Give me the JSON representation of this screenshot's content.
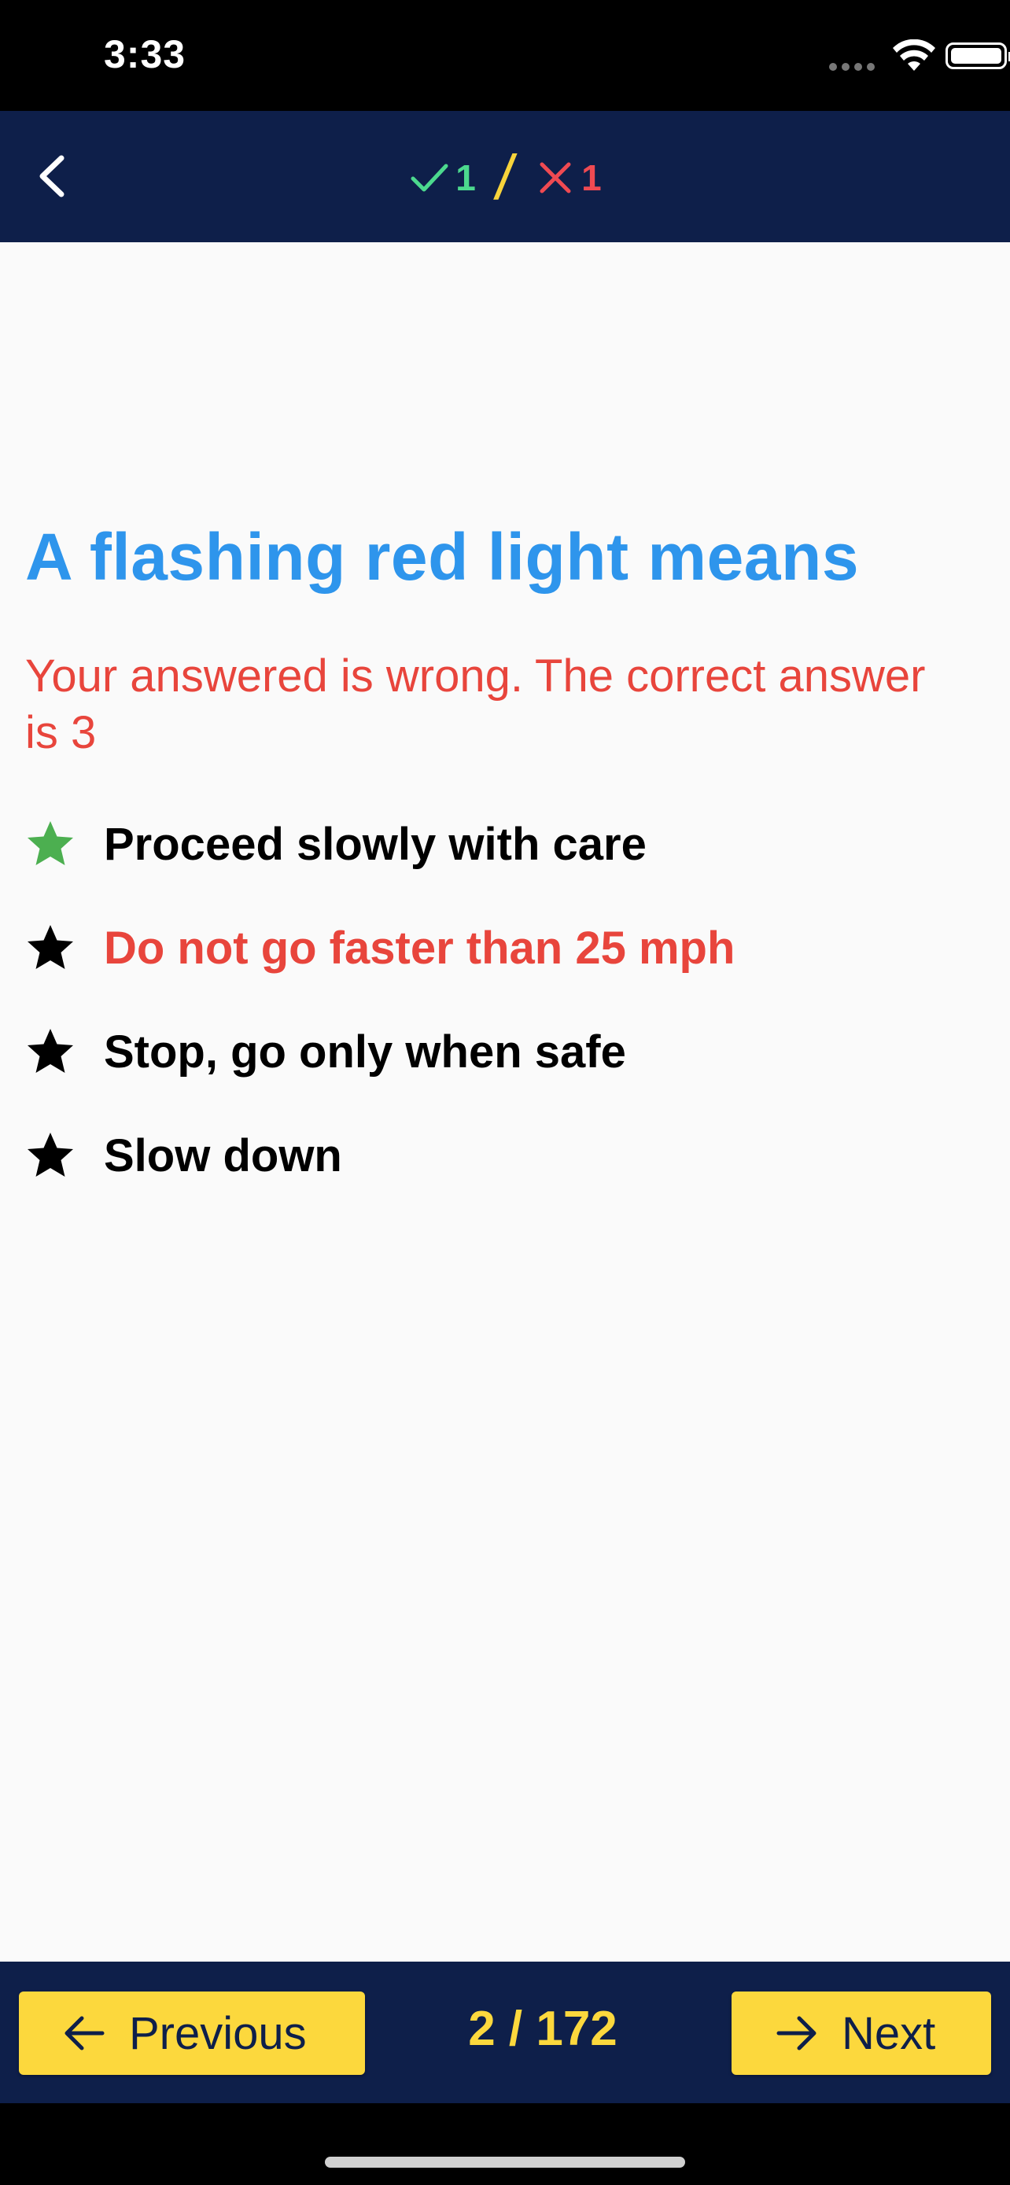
{
  "status_bar": {
    "time": "3:33"
  },
  "header": {
    "score": {
      "correct": "1",
      "divider": "/",
      "wrong": "1"
    },
    "colors": {
      "background": "#0e1f4a",
      "correct": "#4cd98e",
      "wrong": "#ef4a52",
      "divider": "#f7d33b"
    }
  },
  "question": {
    "title": "A flashing red light means",
    "feedback": "Your answered is wrong. The correct answer is 3"
  },
  "answers": [
    {
      "label": "Proceed slowly with care",
      "state": "correct",
      "icon": "star-icon"
    },
    {
      "label": "Do not go faster than 25 mph",
      "state": "selected-wrong",
      "icon": "star-icon"
    },
    {
      "label": "Stop, go only when safe",
      "state": "neutral",
      "icon": "star-icon"
    },
    {
      "label": "Slow down",
      "state": "neutral",
      "icon": "star-icon"
    }
  ],
  "footer": {
    "previous_label": "Previous",
    "next_label": "Next",
    "page": "2 / 172",
    "button_color": "#fcd83d"
  }
}
